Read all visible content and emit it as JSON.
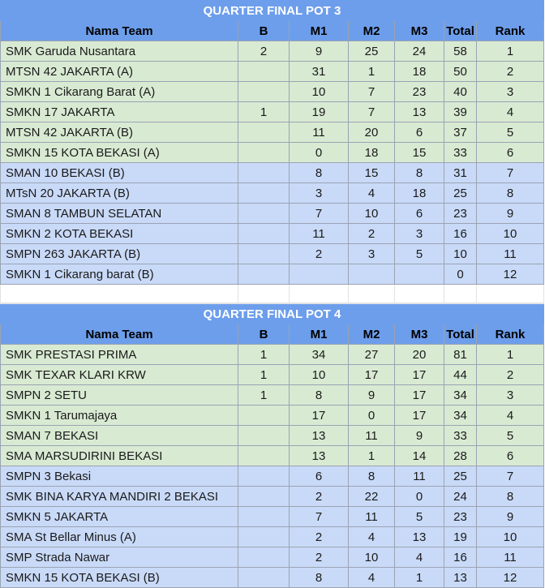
{
  "pot3": {
    "title": "QUARTER FINAL POT 3",
    "headers": [
      "Nama Team",
      "B",
      "M1",
      "M2",
      "M3",
      "Total",
      "Rank"
    ],
    "rows": [
      {
        "name": "SMK Garuda Nusantara",
        "b": "2",
        "m1": "9",
        "m2": "25",
        "m3": "24",
        "total": "58",
        "rank": "1",
        "color": "green"
      },
      {
        "name": "MTSN 42 JAKARTA (A)",
        "b": "",
        "m1": "31",
        "m2": "1",
        "m3": "18",
        "total": "50",
        "rank": "2",
        "color": "green"
      },
      {
        "name": "SMKN 1 Cikarang Barat (A)",
        "b": "",
        "m1": "10",
        "m2": "7",
        "m3": "23",
        "total": "40",
        "rank": "3",
        "color": "green"
      },
      {
        "name": "SMKN 17 JAKARTA",
        "b": "1",
        "m1": "19",
        "m2": "7",
        "m3": "13",
        "total": "39",
        "rank": "4",
        "color": "green"
      },
      {
        "name": "MTSN 42 JAKARTA (B)",
        "b": "",
        "m1": "11",
        "m2": "20",
        "m3": "6",
        "total": "37",
        "rank": "5",
        "color": "green"
      },
      {
        "name": "SMKN 15 KOTA BEKASI (A)",
        "b": "",
        "m1": "0",
        "m2": "18",
        "m3": "15",
        "total": "33",
        "rank": "6",
        "color": "green"
      },
      {
        "name": "SMAN 10 BEKASI (B)",
        "b": "",
        "m1": "8",
        "m2": "15",
        "m3": "8",
        "total": "31",
        "rank": "7",
        "color": "blue"
      },
      {
        "name": "MTsN 20 JAKARTA (B)",
        "b": "",
        "m1": "3",
        "m2": "4",
        "m3": "18",
        "total": "25",
        "rank": "8",
        "color": "blue"
      },
      {
        "name": "SMAN 8 TAMBUN SELATAN",
        "b": "",
        "m1": "7",
        "m2": "10",
        "m3": "6",
        "total": "23",
        "rank": "9",
        "color": "blue"
      },
      {
        "name": "SMKN 2 KOTA BEKASI",
        "b": "",
        "m1": "11",
        "m2": "2",
        "m3": "3",
        "total": "16",
        "rank": "10",
        "color": "blue"
      },
      {
        "name": "SMPN 263 JAKARTA (B)",
        "b": "",
        "m1": "2",
        "m2": "3",
        "m3": "5",
        "total": "10",
        "rank": "11",
        "color": "blue"
      },
      {
        "name": "SMKN 1 Cikarang barat (B)",
        "b": "",
        "m1": "",
        "m2": "",
        "m3": "",
        "total": "0",
        "rank": "12",
        "color": "blue"
      }
    ]
  },
  "pot4": {
    "title": "QUARTER FINAL POT 4",
    "headers": [
      "Nama Team",
      "B",
      "M1",
      "M2",
      "M3",
      "Total",
      "Rank"
    ],
    "rows": [
      {
        "name": "SMK PRESTASI PRIMA",
        "b": "1",
        "m1": "34",
        "m2": "27",
        "m3": "20",
        "total": "81",
        "rank": "1",
        "color": "green"
      },
      {
        "name": "SMK TEXAR KLARI KRW",
        "b": "1",
        "m1": "10",
        "m2": "17",
        "m3": "17",
        "total": "44",
        "rank": "2",
        "color": "green"
      },
      {
        "name": "SMPN 2 SETU",
        "b": "1",
        "m1": "8",
        "m2": "9",
        "m3": "17",
        "total": "34",
        "rank": "3",
        "color": "green"
      },
      {
        "name": "SMKN 1 Tarumajaya",
        "b": "",
        "m1": "17",
        "m2": "0",
        "m3": "17",
        "total": "34",
        "rank": "4",
        "color": "green"
      },
      {
        "name": "SMAN 7 BEKASI",
        "b": "",
        "m1": "13",
        "m2": "11",
        "m3": "9",
        "total": "33",
        "rank": "5",
        "color": "green"
      },
      {
        "name": "SMA MARSUDIRINI BEKASI",
        "b": "",
        "m1": "13",
        "m2": "1",
        "m3": "14",
        "total": "28",
        "rank": "6",
        "color": "green"
      },
      {
        "name": "SMPN 3 Bekasi",
        "b": "",
        "m1": "6",
        "m2": "8",
        "m3": "11",
        "total": "25",
        "rank": "7",
        "color": "blue"
      },
      {
        "name": "SMK BINA KARYA MANDIRI 2 BEKASI",
        "b": "",
        "m1": "2",
        "m2": "22",
        "m3": "0",
        "total": "24",
        "rank": "8",
        "color": "blue"
      },
      {
        "name": "SMKN 5 JAKARTA",
        "b": "",
        "m1": "7",
        "m2": "11",
        "m3": "5",
        "total": "23",
        "rank": "9",
        "color": "blue"
      },
      {
        "name": "SMA St Bellar Minus (A)",
        "b": "",
        "m1": "2",
        "m2": "4",
        "m3": "13",
        "total": "19",
        "rank": "10",
        "color": "blue"
      },
      {
        "name": "SMP Strada Nawar",
        "b": "",
        "m1": "2",
        "m2": "10",
        "m3": "4",
        "total": "16",
        "rank": "11",
        "color": "blue"
      },
      {
        "name": "SMKN 15 KOTA BEKASI (B)",
        "b": "",
        "m1": "8",
        "m2": "4",
        "m3": "1",
        "total": "13",
        "rank": "12",
        "color": "blue"
      }
    ]
  }
}
